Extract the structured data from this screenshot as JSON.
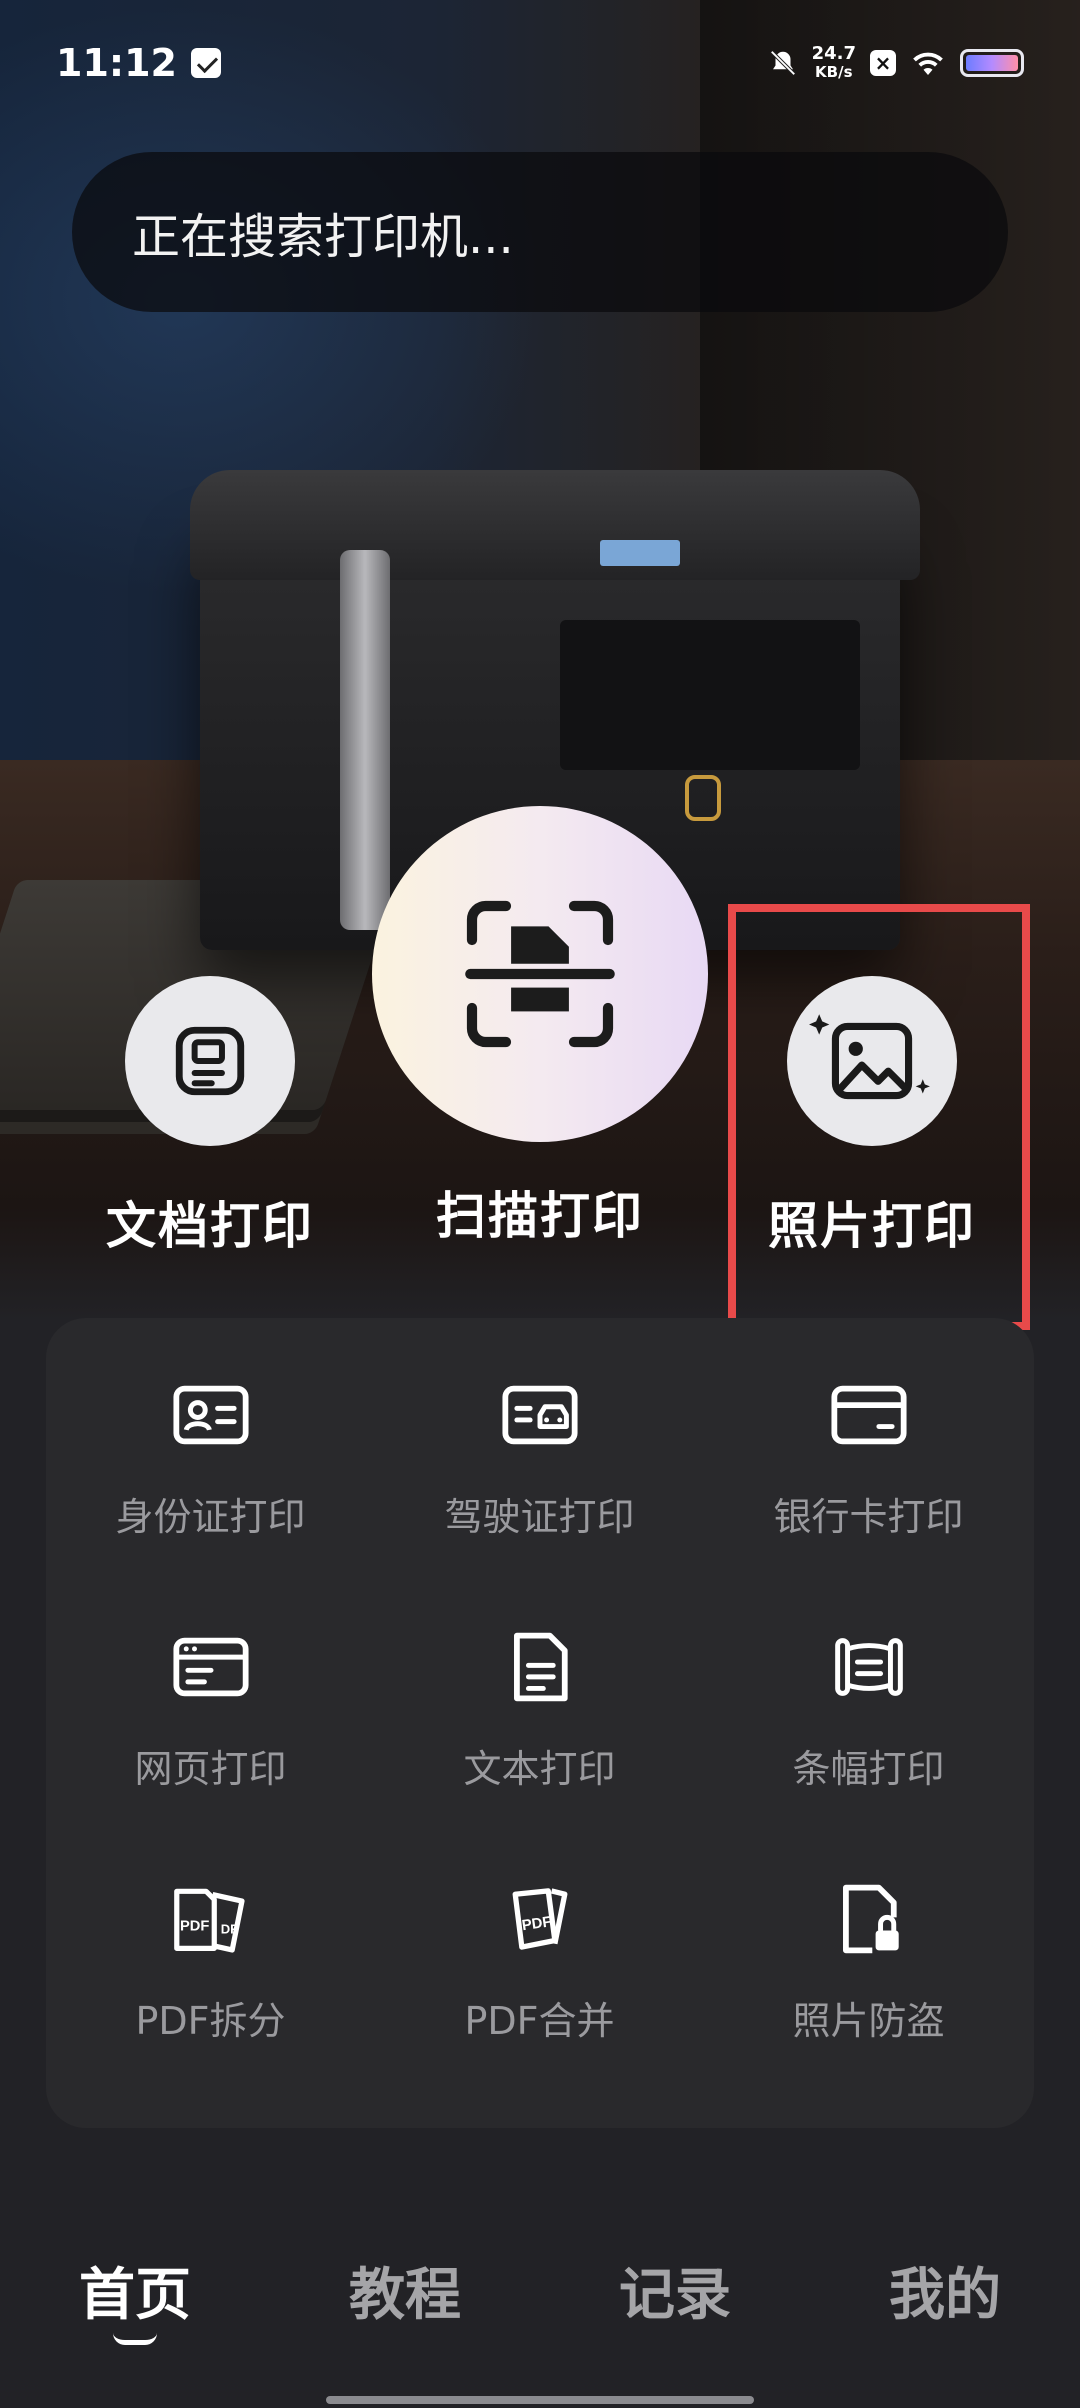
{
  "status_bar": {
    "time": "11:12",
    "net_speed_value": "24.7",
    "net_speed_unit": "KB/s",
    "icons": [
      "mail-icon",
      "bell-off-icon",
      "x-badge-icon",
      "wifi-icon",
      "battery-icon"
    ]
  },
  "search": {
    "text": "正在搜索打印机..."
  },
  "primary_actions": [
    {
      "label": "文档打印",
      "icon": "document-print-icon"
    },
    {
      "label": "扫描打印",
      "icon": "scan-frame-icon"
    },
    {
      "label": "照片打印",
      "icon": "photo-icon"
    }
  ],
  "tools": [
    {
      "label": "身份证打印",
      "icon": "id-card-icon"
    },
    {
      "label": "驾驶证打印",
      "icon": "driver-license-icon"
    },
    {
      "label": "银行卡打印",
      "icon": "bank-card-icon"
    },
    {
      "label": "网页打印",
      "icon": "webpage-icon"
    },
    {
      "label": "文本打印",
      "icon": "text-file-icon"
    },
    {
      "label": "条幅打印",
      "icon": "banner-icon"
    },
    {
      "label": "PDF拆分",
      "icon": "pdf-split-icon"
    },
    {
      "label": "PDF合并",
      "icon": "pdf-merge-icon"
    },
    {
      "label": "照片防盗",
      "icon": "photo-lock-icon"
    }
  ],
  "bottom_nav": [
    {
      "label": "首页",
      "active": true
    },
    {
      "label": "教程",
      "active": false
    },
    {
      "label": "记录",
      "active": false
    },
    {
      "label": "我的",
      "active": false
    }
  ],
  "colors": {
    "highlight": "#e84a4a",
    "panel": "#29292c",
    "background": "#222226"
  }
}
